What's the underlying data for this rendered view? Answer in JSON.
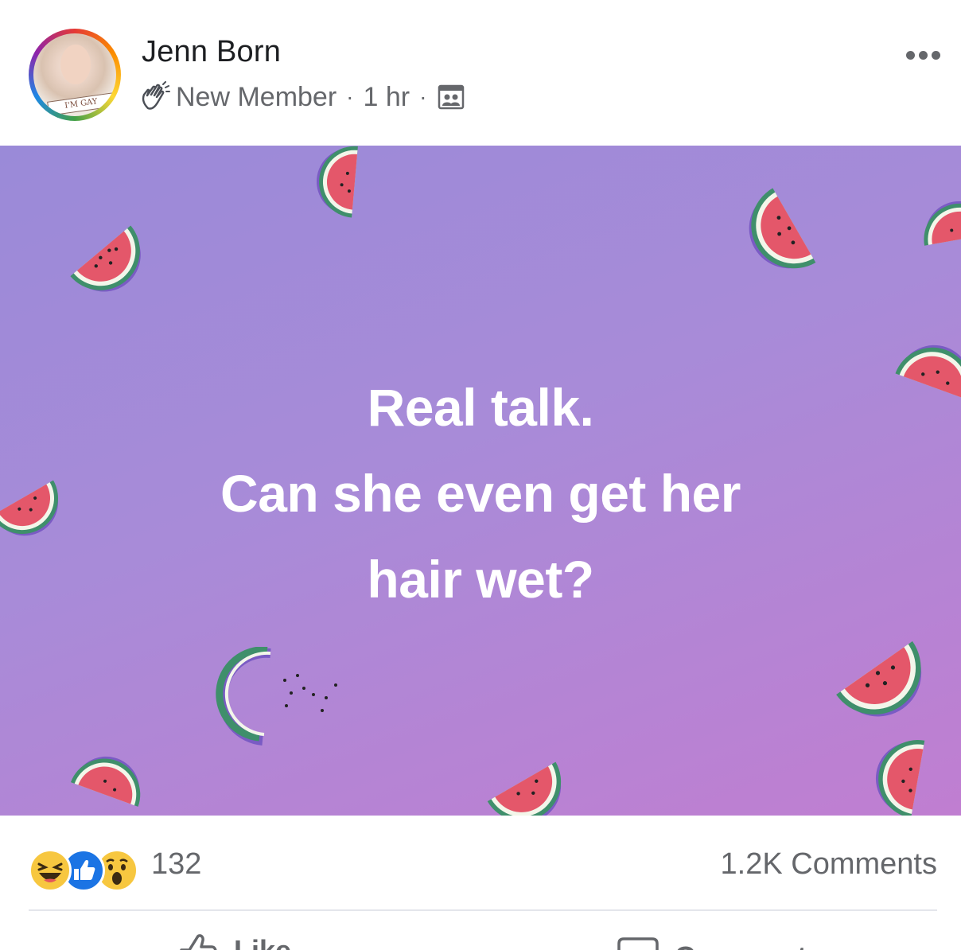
{
  "post": {
    "author": "Jenn Born",
    "avatar_banner": "I'M GAY",
    "badge": "New Member",
    "time": "1 hr",
    "separator": "·",
    "text_lines": [
      "Real talk.",
      "Can she even get her",
      "hair wet?"
    ],
    "background_colors": {
      "start": "#9a8ad8",
      "end": "#c07ed1"
    },
    "icons": {
      "badge": "waving-hand-icon",
      "audience": "group-audience-icon",
      "menu": "more-options-icon"
    }
  },
  "reactions": {
    "types": [
      "haha",
      "like",
      "wow"
    ],
    "count": "132",
    "comments": "1.2K Comments"
  },
  "actions": {
    "like_label": "Like",
    "comment_label": "Comment"
  },
  "colors": {
    "secondary_text": "#65676b",
    "like_blue": "#1b74e4",
    "emoji_yellow": "#f7c740"
  }
}
